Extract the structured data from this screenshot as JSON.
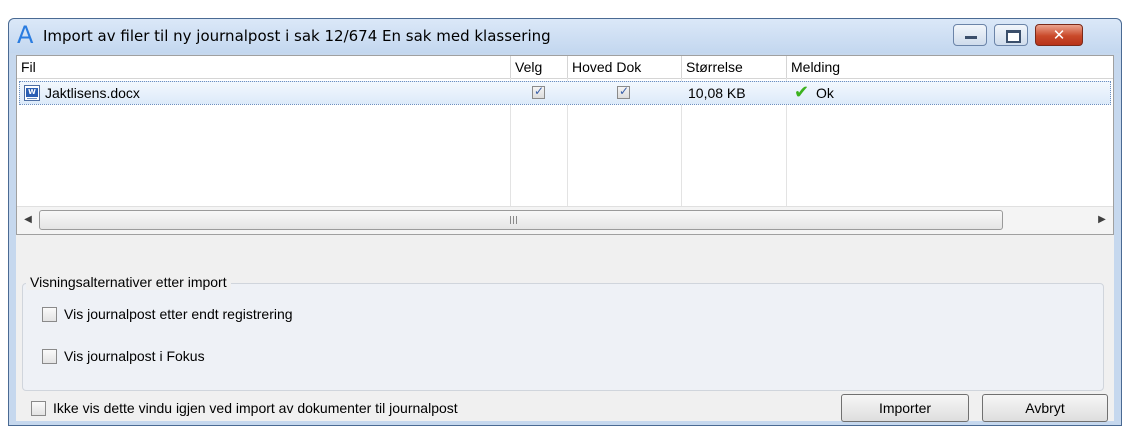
{
  "window": {
    "title": "Import av filer til ny journalpost i sak 12/674 En sak med klassering",
    "app_icon": "A",
    "controls": {
      "minimize": "minimize-icon",
      "maximize": "maximize-icon",
      "close": "✕"
    }
  },
  "grid": {
    "columns": [
      "Fil",
      "Velg",
      "Hoved Dok",
      "Størrelse",
      "Melding"
    ],
    "rows": [
      {
        "file": "Jaktlisens.docx",
        "file_icon": "word-document-icon",
        "select": true,
        "main_doc": true,
        "size": "10,08 KB",
        "message": "Ok",
        "status_icon": "✔"
      }
    ]
  },
  "scrollbar": {
    "left": "◀",
    "right": "▶"
  },
  "options": {
    "legend": "Visningsalternativer etter import",
    "items": [
      {
        "label": "Vis journalpost etter endt registrering",
        "checked": false
      },
      {
        "label": "Vis journalpost i Fokus",
        "checked": false
      }
    ]
  },
  "footer": {
    "dont_show_label": "Ikke vis dette vindu igjen ved import av dokumenter til journalpost",
    "dont_show_checked": false,
    "import_button": "Importer",
    "cancel_button": "Avbryt"
  },
  "colors": {
    "accent": "#2a7ce0",
    "ok": "#3cb21d",
    "selection": "#dceafa",
    "close": "#c9492a"
  }
}
